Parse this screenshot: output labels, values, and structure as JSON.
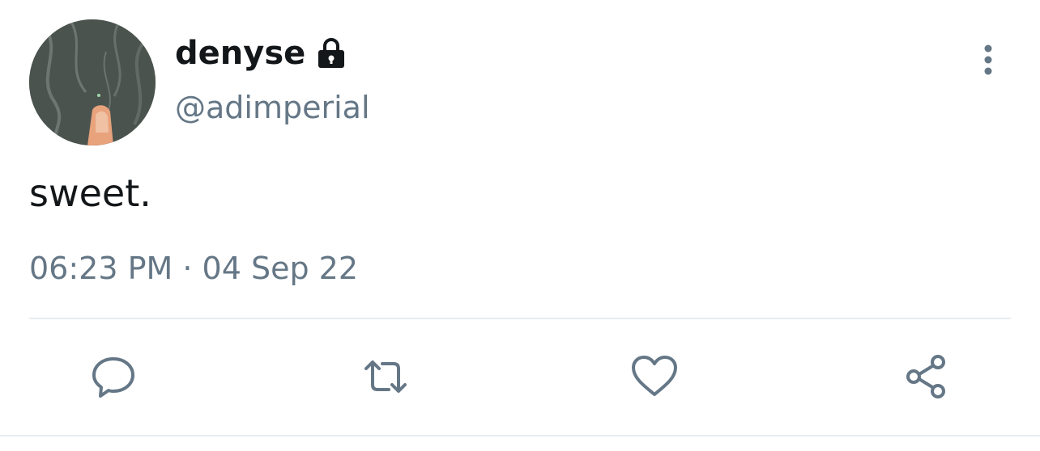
{
  "user": {
    "display_name": "denyse",
    "handle": "@adimperial",
    "protected_icon": "lock-icon",
    "avatar": "avatar-illustration"
  },
  "tweet": {
    "text": "sweet.",
    "timestamp": "06:23 PM · 04 Sep 22"
  },
  "menu": {
    "icon": "vertical-ellipsis-icon"
  },
  "actions": [
    {
      "name": "reply",
      "icon": "speech-bubble-icon"
    },
    {
      "name": "retweet",
      "icon": "retweet-arrows-icon"
    },
    {
      "name": "like",
      "icon": "heart-icon"
    },
    {
      "name": "share",
      "icon": "share-nodes-icon"
    }
  ],
  "colors": {
    "text_primary": "#14171a",
    "text_secondary": "#657786",
    "icon": "#657786",
    "divider": "#e6ecf0"
  }
}
